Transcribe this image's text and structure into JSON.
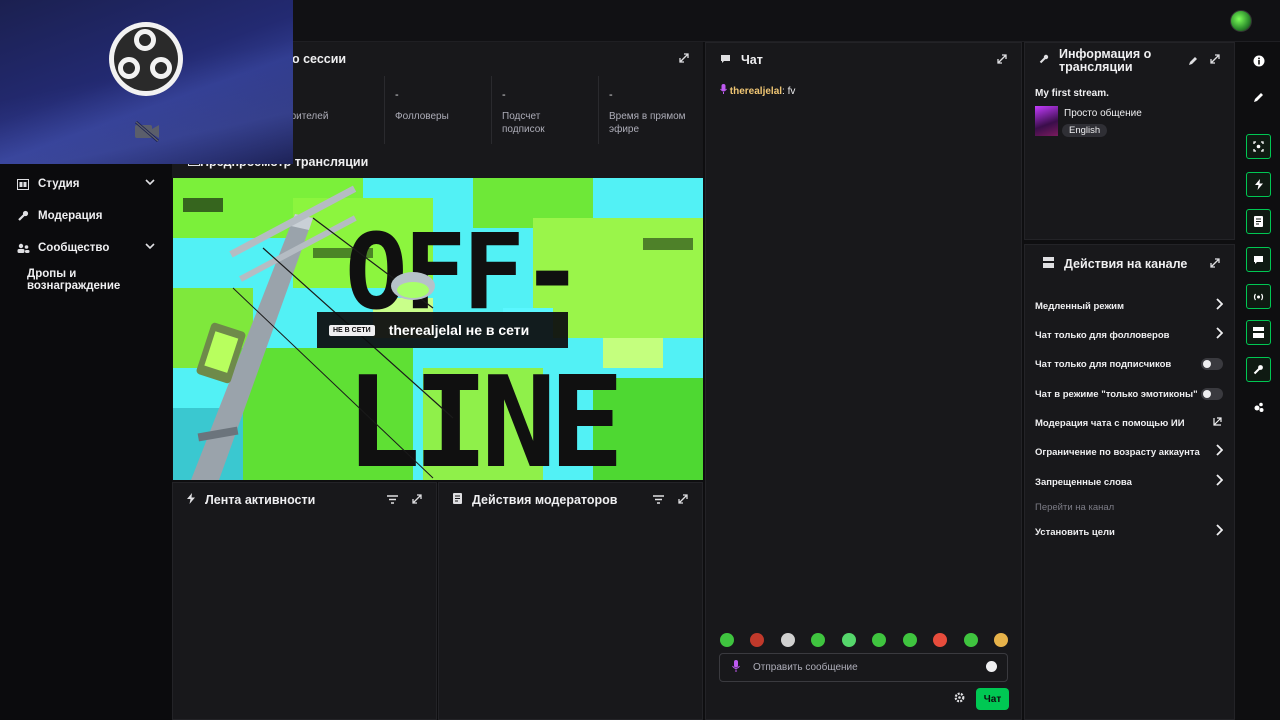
{
  "sidebar": {
    "items": [
      {
        "label": "Студия",
        "icon": "studio-icon",
        "expandable": true
      },
      {
        "label": "Модерация",
        "icon": "wrench-icon",
        "expandable": false
      },
      {
        "label": "Сообщество",
        "icon": "community-icon",
        "expandable": true
      },
      {
        "label": "Дропы и вознаграждение",
        "icon": "",
        "expandable": false
      }
    ]
  },
  "session": {
    "title": "о сессии",
    "stats": [
      {
        "value": "",
        "label": "зрителей"
      },
      {
        "value": "-",
        "label": "Фолловеры"
      },
      {
        "value": "-",
        "label": "Подсчет подписок"
      },
      {
        "value": "-",
        "label": "Время в прямом эфире"
      }
    ]
  },
  "preview": {
    "title": "Предпросмотр трансляции",
    "badge": "НЕ В СЕТИ",
    "status_text": "therealjelal не в сети",
    "art_text_1": "OFF-",
    "art_text_2": "LINE"
  },
  "activity": {
    "title": "Лента активности"
  },
  "mod_actions": {
    "title": "Действия модераторов"
  },
  "chat": {
    "title": "Чат",
    "messages": [
      {
        "user": "therealjelal",
        "text": ": fv"
      }
    ],
    "input_placeholder": "Отправить сообщение",
    "send_label": "Чат"
  },
  "stream_info": {
    "title": "Информация о трансляции",
    "stream_title": "My first stream.",
    "category": "Просто общение",
    "language": "English"
  },
  "channel_actions": {
    "title": "Действия на канале",
    "items": [
      {
        "label": "Медленный режим",
        "control": "chevron"
      },
      {
        "label": "Чат только для фолловеров",
        "control": "chevron"
      },
      {
        "label": "Чат только для подписчиков",
        "control": "toggle"
      },
      {
        "label": "Чат в режиме \"только эмотиконы\"",
        "control": "toggle"
      },
      {
        "label": "Модерация чата с помощью ИИ",
        "control": "external"
      },
      {
        "label": "Ограничение по возрасту аккаунта",
        "control": "chevron"
      },
      {
        "label": "Запрещенные слова",
        "control": "chevron"
      },
      {
        "label": "Перейти на канал",
        "control": "none"
      },
      {
        "label": "Установить цели",
        "control": "chevron"
      }
    ]
  },
  "colors": {
    "accent_green": "#00c853",
    "background": "#0e0e10",
    "panel": "#18181b",
    "username": "#f0c674"
  }
}
